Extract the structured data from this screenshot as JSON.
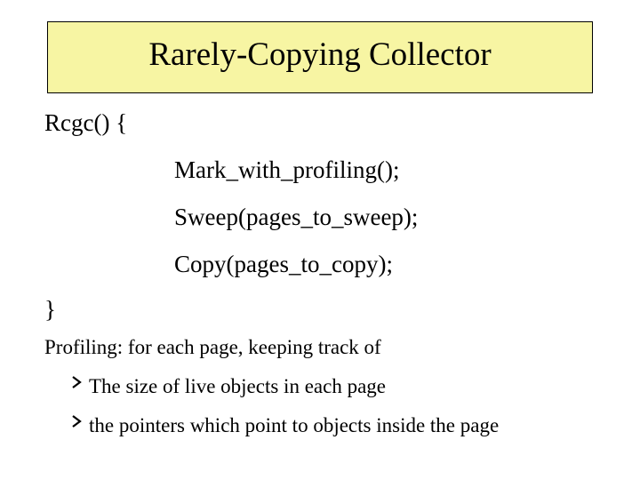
{
  "title": "Rarely-Copying Collector",
  "code": {
    "open": "Rcgc() {",
    "line1": "Mark_with_profiling();",
    "line2": "Sweep(pages_to_sweep);",
    "line3": "Copy(pages_to_copy);",
    "close": "}"
  },
  "profiling_heading": "Profiling: for each page, keeping track of",
  "bullets": {
    "b1": "The size of live objects in each page",
    "b2": "the pointers which point to objects inside the page"
  }
}
